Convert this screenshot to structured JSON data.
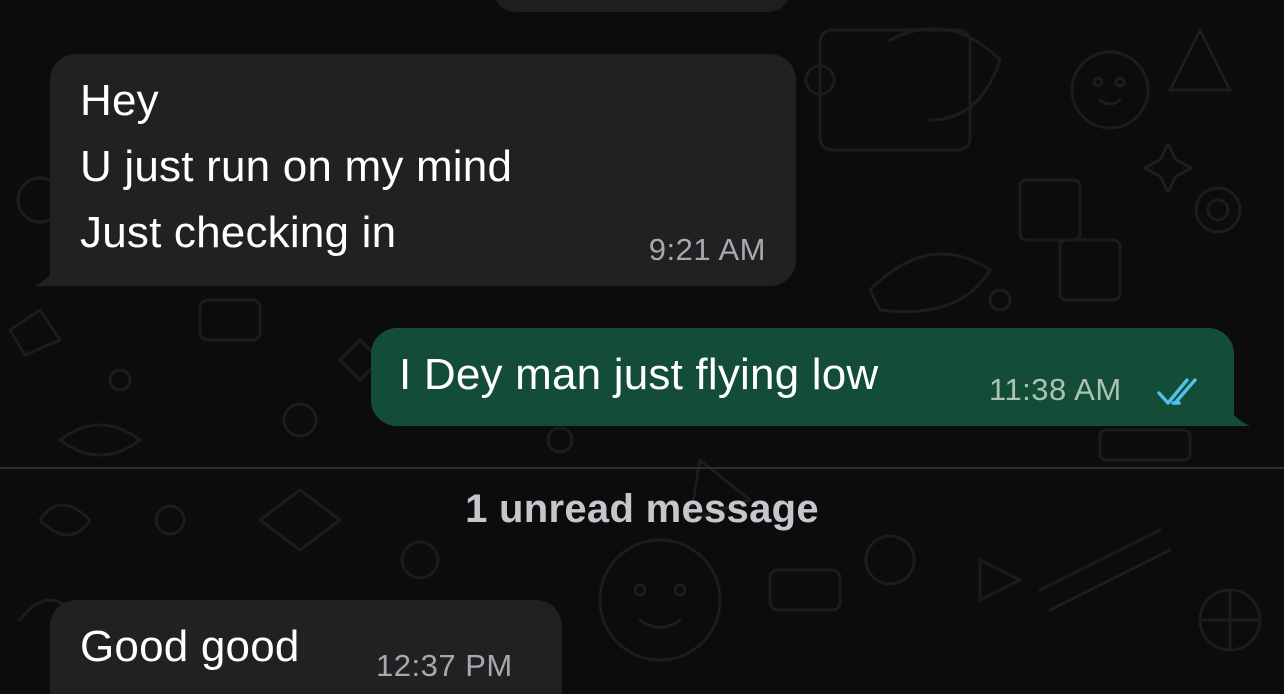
{
  "messages": [
    {
      "direction": "incoming",
      "lines": [
        "Hey",
        "U just run on my mind",
        "Just checking in"
      ],
      "time": "9:21 AM"
    },
    {
      "direction": "outgoing",
      "text": "I Dey man just flying low",
      "time": "11:38 AM",
      "status": "read",
      "status_icon": "double-check-icon"
    },
    {
      "direction": "incoming",
      "text": "Good good",
      "time": "12:37 PM"
    }
  ],
  "unread_divider": {
    "label": "1 unread message"
  },
  "colors": {
    "background": "#0c0c0c",
    "incoming_bubble": "#222022",
    "outgoing_bubble": "#144d37",
    "read_ticks": "#53bdeb"
  }
}
